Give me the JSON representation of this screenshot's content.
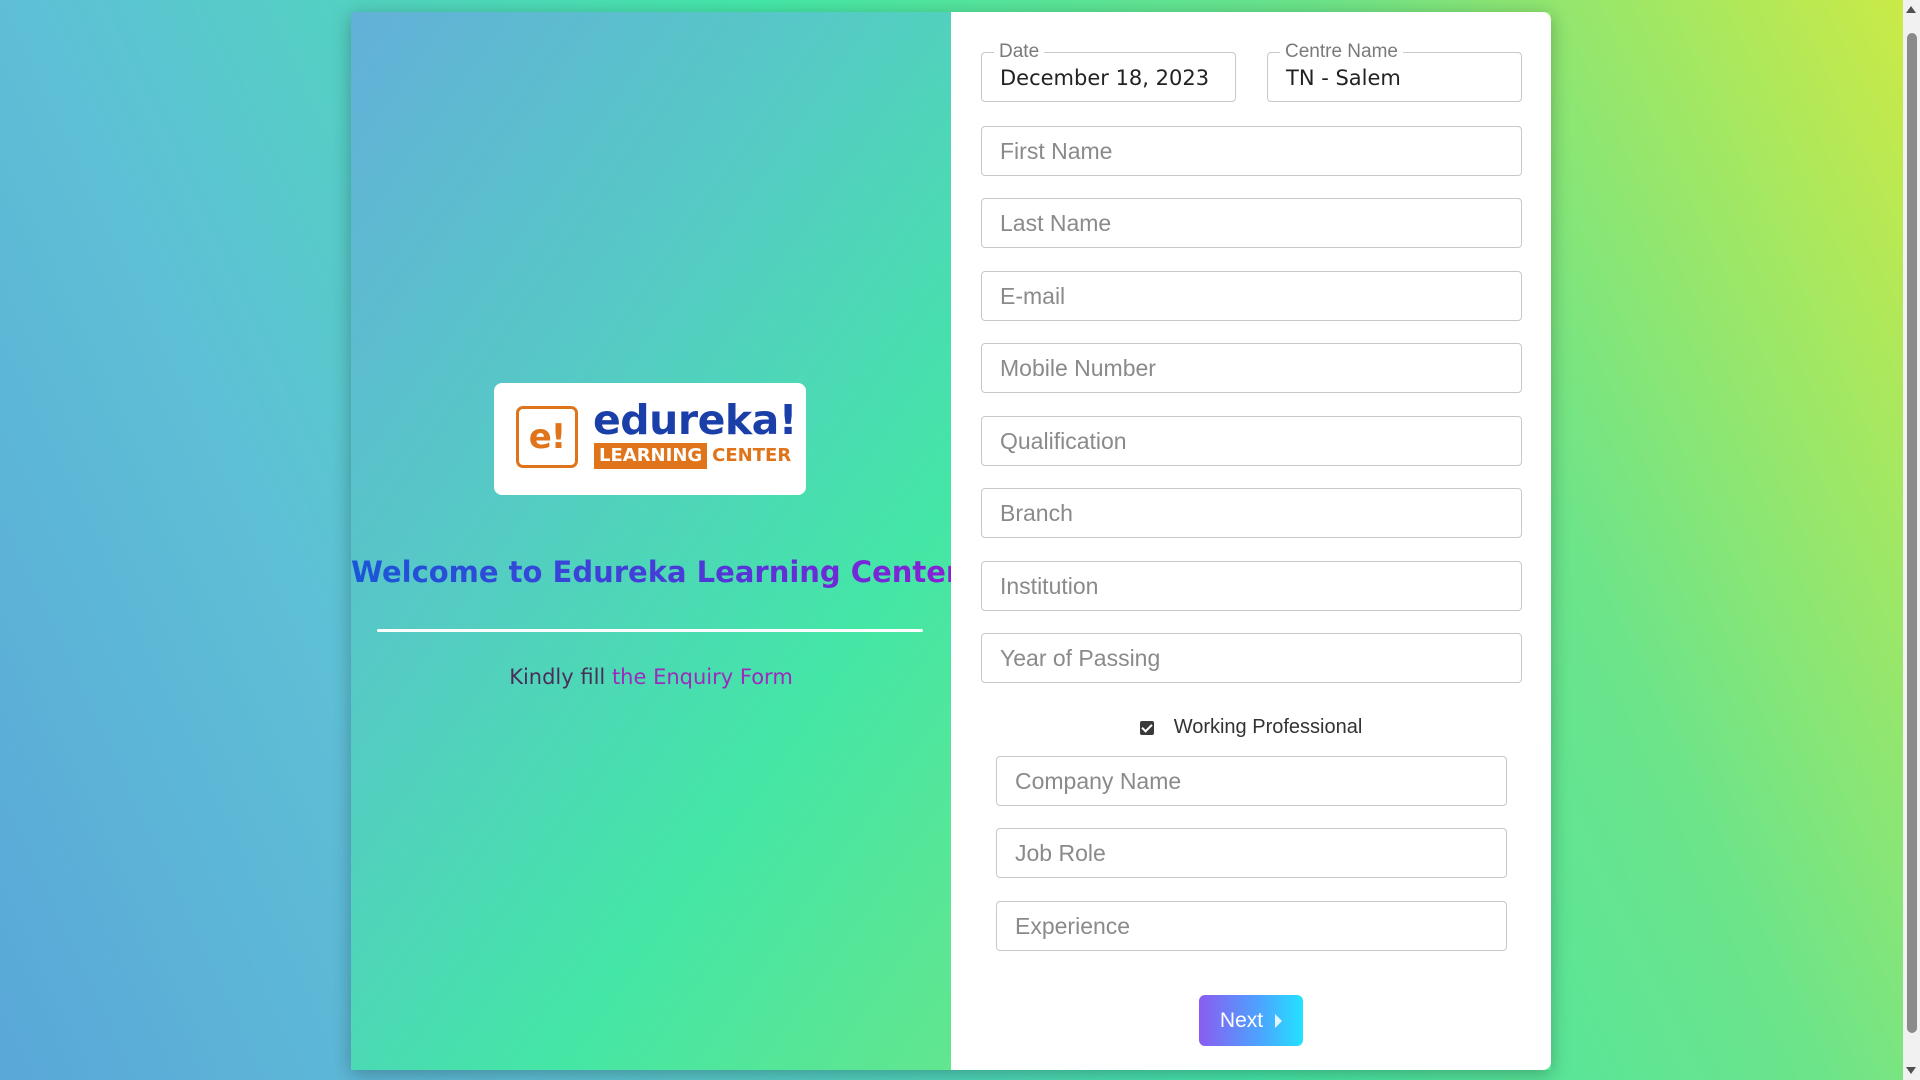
{
  "brand": {
    "logo_mark": "e!",
    "logo_word": "edureka!",
    "logo_sub_a": "LEARNING",
    "logo_sub_b": "CENTER"
  },
  "intro": {
    "welcome": "Welcome to Edureka Learning Center",
    "kindly_prefix": "Kindly fill ",
    "kindly_the": "the ",
    "kindly_form": "Enquiry Form"
  },
  "form": {
    "date_label": "Date",
    "date_value": "December 18, 2023",
    "centre_label": "Centre Name",
    "centre_value": "TN - Salem",
    "first_name": "First Name",
    "last_name": "Last Name",
    "email": "E-mail",
    "mobile": "Mobile Number",
    "qualification": "Qualification",
    "branch": "Branch",
    "institution": "Institution",
    "year_of_passing": "Year of Passing",
    "working_professional_label": "Working Professional",
    "working_professional_checked": true,
    "company_name": "Company Name",
    "job_role": "Job Role",
    "experience": "Experience",
    "next_label": "Next"
  },
  "colors": {
    "accent_orange": "#e0741b",
    "logo_blue": "#1b3fa8",
    "welcome_gradient_start": "#1a56d8",
    "welcome_gradient_end": "#8a1ed6",
    "enquiry_purple": "#9b2bbd",
    "button_gradient_start": "#8a5cf0",
    "button_gradient_end": "#23e2ff"
  },
  "icons": {
    "next_button_icon": "caret-right-icon",
    "checkbox_icon": "checkmark-icon"
  }
}
